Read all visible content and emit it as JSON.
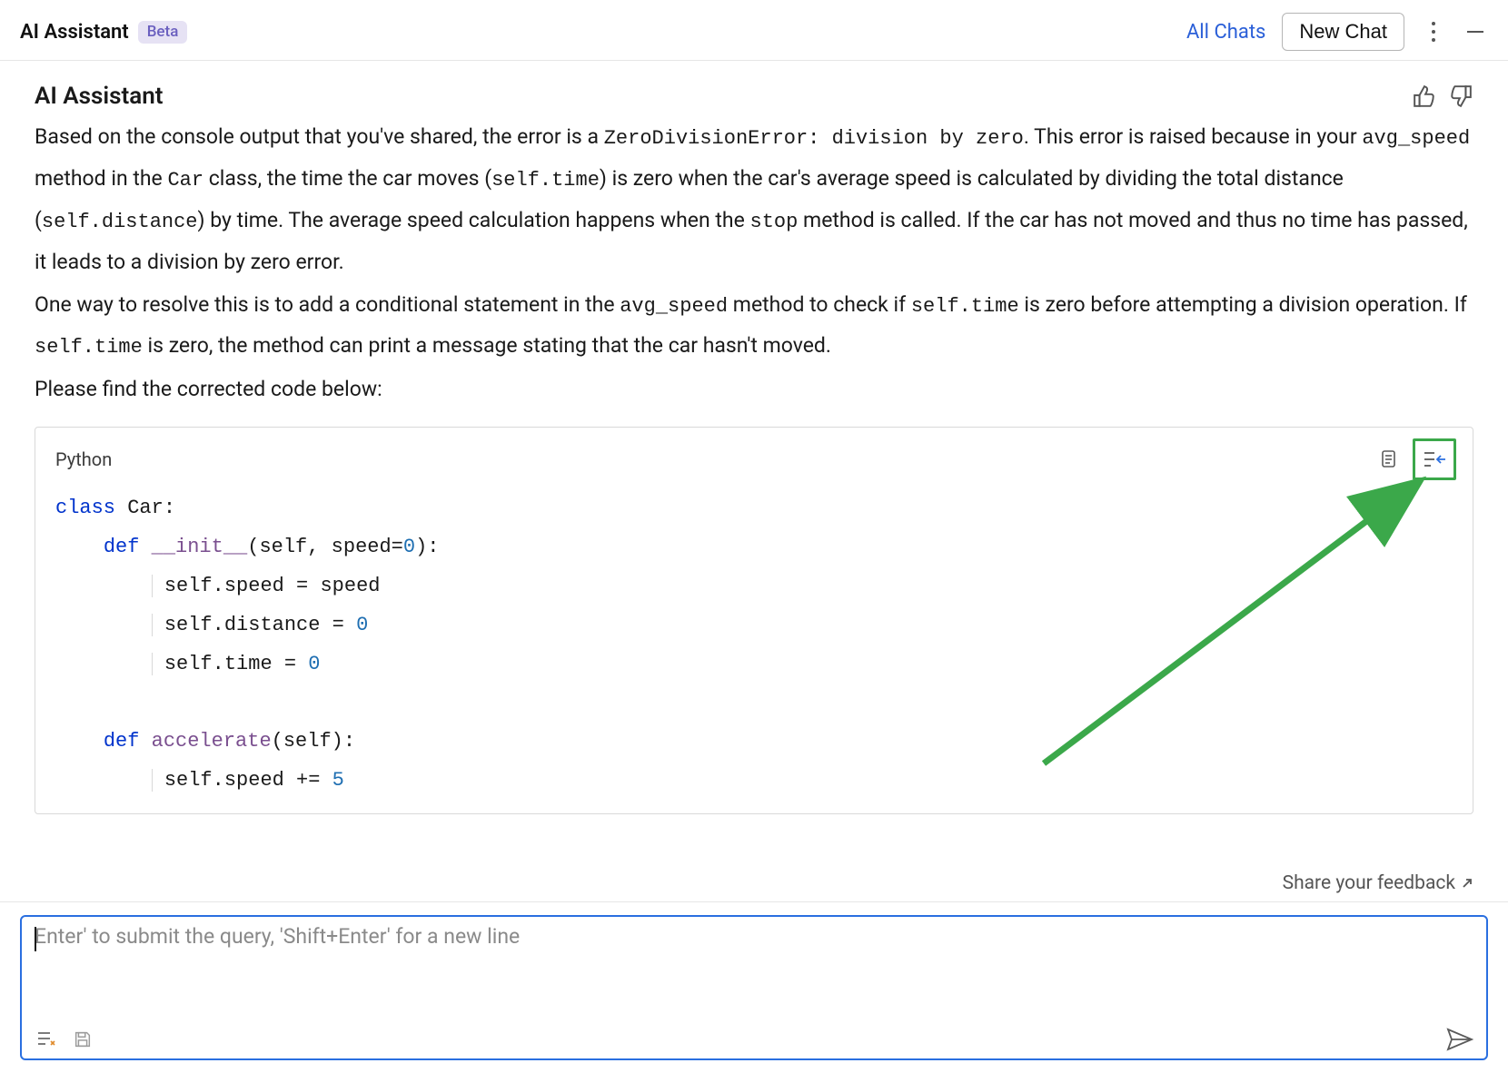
{
  "header": {
    "title": "AI Assistant",
    "badge": "Beta",
    "all_chats": "All Chats",
    "new_chat": "New Chat"
  },
  "message": {
    "author": "AI Assistant",
    "para1_parts": {
      "t1": "Based on the console output that you've shared, the error is a ",
      "c1": "ZeroDivisionError: division by zero",
      "t2": ". This error is raised because in your ",
      "c2": "avg_speed",
      "t3": " method in the ",
      "c3": "Car",
      "t4": " class, the time the car moves (",
      "c4": "self.time",
      "t5": ") is zero when the car's average speed is calculated by dividing the total distance (",
      "c5": "self.distance",
      "t6": ") by time. The average speed calculation happens when the ",
      "c6": "stop",
      "t7": " method is called. If the car has not moved and thus no time has passed, it leads to a division by zero error."
    },
    "para2_parts": {
      "t1": "One way to resolve this is to add a conditional statement in the ",
      "c1": "avg_speed",
      "t2": " method to check if ",
      "c2": "self.time",
      "t3": " is zero before attempting a division operation. If ",
      "c3": "self.time",
      "t4": " is zero, the method can print a message stating that the car hasn't moved."
    },
    "para3": "Please find the corrected code below:"
  },
  "code": {
    "language": "Python",
    "lines": {
      "l1_kw": "class",
      "l1_name": " Car:",
      "l2_kw": "def",
      "l2_fn": " __init__",
      "l2_sig": "(self, speed=",
      "l2_num": "0",
      "l2_end": "):",
      "l3": "self.speed = speed",
      "l4_a": "self.distance = ",
      "l4_num": "0",
      "l5_a": "self.time = ",
      "l5_num": "0",
      "l6_kw": "def",
      "l6_fn": " accelerate",
      "l6_sig": "(self):",
      "l7_a": "self.speed += ",
      "l7_num": "5"
    }
  },
  "feedback": {
    "label": "Share your feedback"
  },
  "input": {
    "placeholder": "Enter' to submit the query, 'Shift+Enter' for a new line"
  },
  "icons": {
    "more": "more-vert-icon",
    "minimize": "minimize-icon",
    "thumbs_up": "thumbs-up-icon",
    "thumbs_down": "thumbs-down-icon",
    "copy": "copy-icon",
    "insert": "insert-code-icon",
    "open_external": "open-external-icon",
    "attach": "attach-icon",
    "save": "save-icon",
    "send": "send-icon"
  }
}
